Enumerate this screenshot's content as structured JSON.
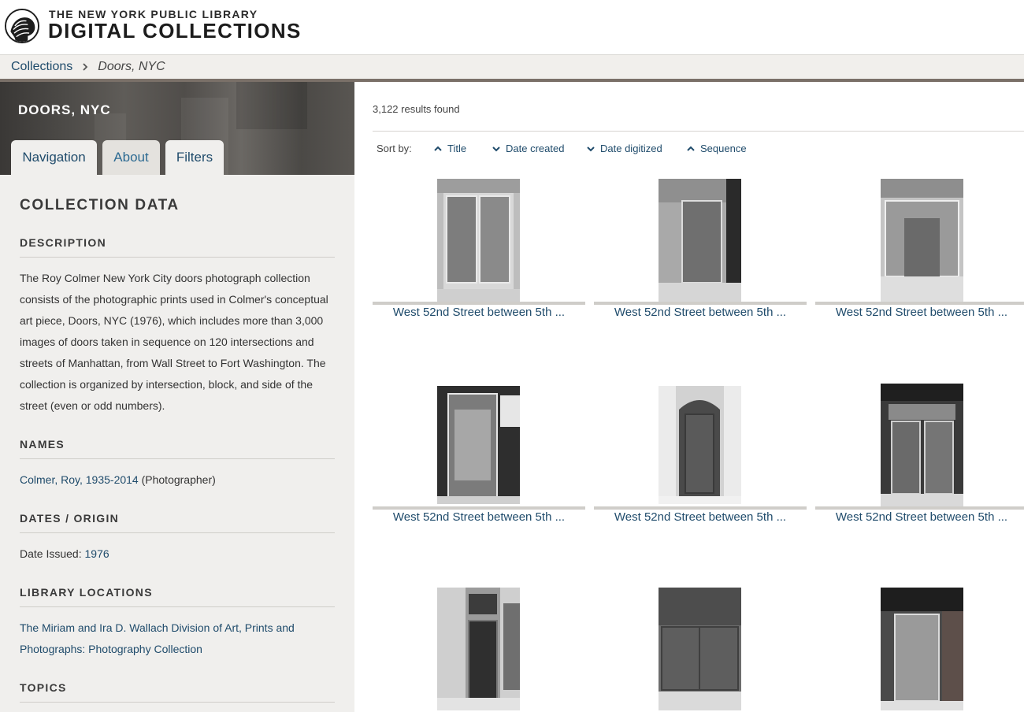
{
  "header": {
    "brand_top": "THE NEW YORK PUBLIC LIBRARY",
    "brand_main": "DIGITAL COLLECTIONS"
  },
  "breadcrumb": {
    "collections": "Collections",
    "current": "Doors, NYC"
  },
  "collection": {
    "title": "DOORS, NYC",
    "tabs": [
      {
        "label": "Navigation",
        "active": false
      },
      {
        "label": "About",
        "active": true
      },
      {
        "label": "Filters",
        "active": false
      }
    ],
    "section_title": "COLLECTION DATA",
    "description_heading": "DESCRIPTION",
    "description": "The Roy Colmer New York City doors photograph collection consists of the photographic prints used in Colmer's conceptual art piece, Doors, NYC (1976), which includes more than 3,000 images of doors taken in sequence on 120 intersections and streets of Manhattan, from Wall Street to Fort Washington. The collection is organized by intersection, block, and side of the street (even or odd numbers).",
    "names_heading": "NAMES",
    "name_link": "Colmer, Roy, 1935-2014",
    "name_role": " (Photographer)",
    "dates_heading": "DATES / ORIGIN",
    "date_label": "Date Issued: ",
    "date_value": "1976",
    "locations_heading": "LIBRARY LOCATIONS",
    "location_line1": "The Miriam and Ira D. Wallach Division of Art, Prints and",
    "location_line2": "Photographs: Photography Collection",
    "topics_heading": "TOPICS"
  },
  "results": {
    "count": "3,122 results found",
    "sort_label": "Sort by:",
    "sort_options": [
      {
        "label": "Title",
        "icon": "chevron-up-icon"
      },
      {
        "label": "Date created",
        "icon": "chevron-down-icon"
      },
      {
        "label": "Date digitized",
        "icon": "chevron-down-icon"
      },
      {
        "label": "Sequence",
        "icon": "chevron-up-icon"
      }
    ],
    "items": [
      {
        "title": "West 52nd Street between 5th ..."
      },
      {
        "title": "West 52nd Street between 5th ..."
      },
      {
        "title": "West 52nd Street between 5th ..."
      },
      {
        "title": "West 52nd Street between 5th ..."
      },
      {
        "title": "West 52nd Street between 5th ..."
      },
      {
        "title": "West 52nd Street between 5th ..."
      },
      {
        "title": ""
      },
      {
        "title": ""
      },
      {
        "title": ""
      }
    ]
  },
  "colors": {
    "link": "#1f4b6b",
    "panel_bg": "#f0efed",
    "rule": "#7a7068"
  }
}
